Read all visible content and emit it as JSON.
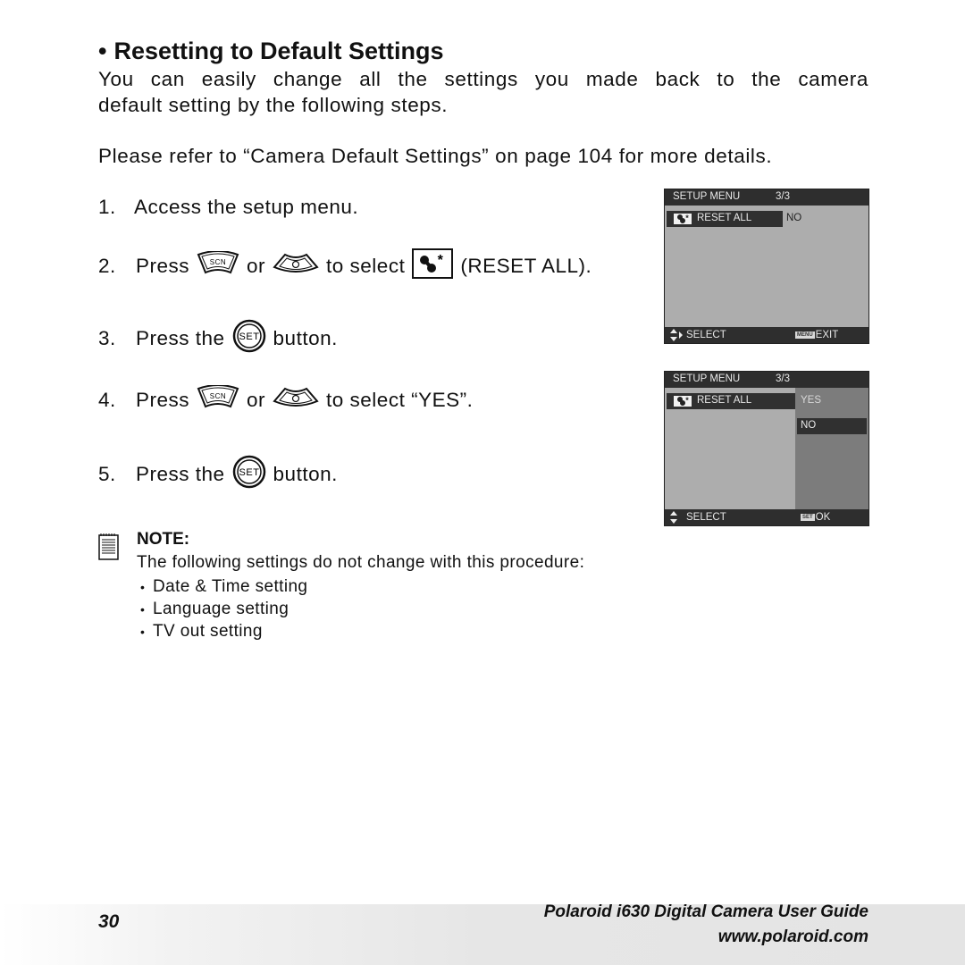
{
  "heading": {
    "bullet": "•",
    "title": "Resetting to Default Settings"
  },
  "intro": {
    "line1_words": [
      "You",
      "can",
      "easily",
      "change",
      "all",
      "the",
      "settings",
      "you",
      "made",
      "back",
      "to",
      "the",
      "camera"
    ],
    "line2": "default setting by the following steps.",
    "reference": "Please refer to “Camera Default Settings” on page 104 for more details."
  },
  "steps": [
    {
      "num": "1.",
      "text": "Access the setup menu."
    },
    {
      "num": "2.",
      "pre": "Press",
      "mid": "or",
      "post": "to select",
      "suffix": "(RESET ALL).",
      "icons": [
        "scn-button-icon",
        "self-timer-button-icon",
        "reset-all-icon"
      ]
    },
    {
      "num": "3.",
      "pre": "Press the",
      "post": "button.",
      "icons": [
        "set-button-icon"
      ]
    },
    {
      "num": "4.",
      "pre": "Press",
      "mid": "or",
      "post": "to select “YES”.",
      "icons": [
        "scn-button-icon",
        "self-timer-button-icon"
      ]
    },
    {
      "num": "5.",
      "pre": "Press the",
      "post": "button.",
      "icons": [
        "set-button-icon"
      ]
    }
  ],
  "button_labels": {
    "scn": "SCN",
    "set": "SET"
  },
  "screens": [
    {
      "header": "SETUP MENU",
      "page": "3/3",
      "item": "RESET ALL",
      "value": "NO",
      "footer_left": "SELECT",
      "footer_key": "MENU",
      "footer_right": "EXIT"
    },
    {
      "header": "SETUP MENU",
      "page": "3/3",
      "item": "RESET ALL",
      "options": [
        "YES",
        "NO"
      ],
      "selected_option": "NO",
      "footer_left": "SELECT",
      "footer_key": "SET",
      "footer_right": "OK"
    }
  ],
  "note": {
    "title": "NOTE:",
    "text": "The following settings do not change with this procedure:",
    "bullet": "•",
    "items": [
      "Date & Time setting",
      "Language setting",
      "TV out setting"
    ]
  },
  "footer": {
    "page_number": "30",
    "guide_title": "Polaroid i630 Digital Camera User Guide",
    "website": "www.polaroid.com"
  }
}
